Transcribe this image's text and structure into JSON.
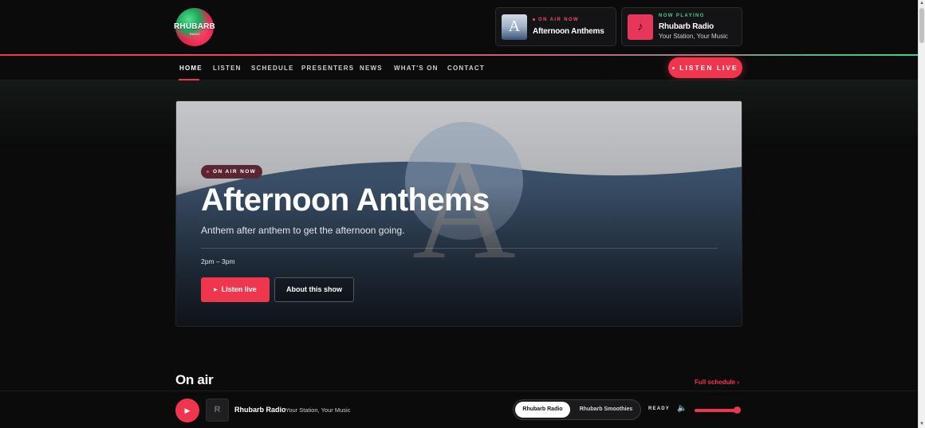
{
  "brand": {
    "logo_text": "RHUBARB",
    "logo_sub": "RADIO"
  },
  "header": {
    "on_air_card": {
      "kicker": "ON AIR NOW",
      "title": "Afternoon Anthems",
      "thumb_letter": "A"
    },
    "now_playing_card": {
      "kicker": "NOW PLAYING",
      "title": "Rhubarb Radio",
      "subtitle": "Your Station, Your Music",
      "thumb_icon": "music-note-icon",
      "thumb_glyph": "♪"
    }
  },
  "nav": {
    "items": [
      {
        "label": "HOME",
        "active": true
      },
      {
        "label": "LISTEN",
        "active": false
      },
      {
        "label": "SCHEDULE",
        "active": false
      },
      {
        "label": "PRESENTERS",
        "active": false
      },
      {
        "label": "NEWS",
        "active": false
      },
      {
        "label": "WHAT'S ON",
        "active": false
      },
      {
        "label": "CONTACT",
        "active": false
      }
    ],
    "listen_live": "LISTEN LIVE"
  },
  "hero": {
    "badge": "ON AIR NOW",
    "title": "Afternoon Anthems",
    "description": "Anthem after anthem to get the afternoon going.",
    "time": "2pm – 3pm",
    "primary_button": "Listen live",
    "secondary_button": "About this show",
    "art_letter": "A"
  },
  "on_air_section": {
    "title": "On air",
    "link": "Full schedule",
    "link_icon": "chevron-right-icon",
    "link_glyph": "›"
  },
  "player": {
    "play_glyph": "▶",
    "art_letter": "R",
    "station_name": "Rhubarb Radio",
    "station_tagline": "Your Station, Your Music",
    "stations": [
      "Rhubarb Radio",
      "Rhubarb Smoothies"
    ],
    "selected_station": "Rhubarb Radio",
    "status": "READY",
    "volume_icon_glyph": "🔈",
    "volume": 0.95
  },
  "colors": {
    "accent": "#f0364f",
    "green": "#3fd38b",
    "background": "#0b0b0c"
  }
}
